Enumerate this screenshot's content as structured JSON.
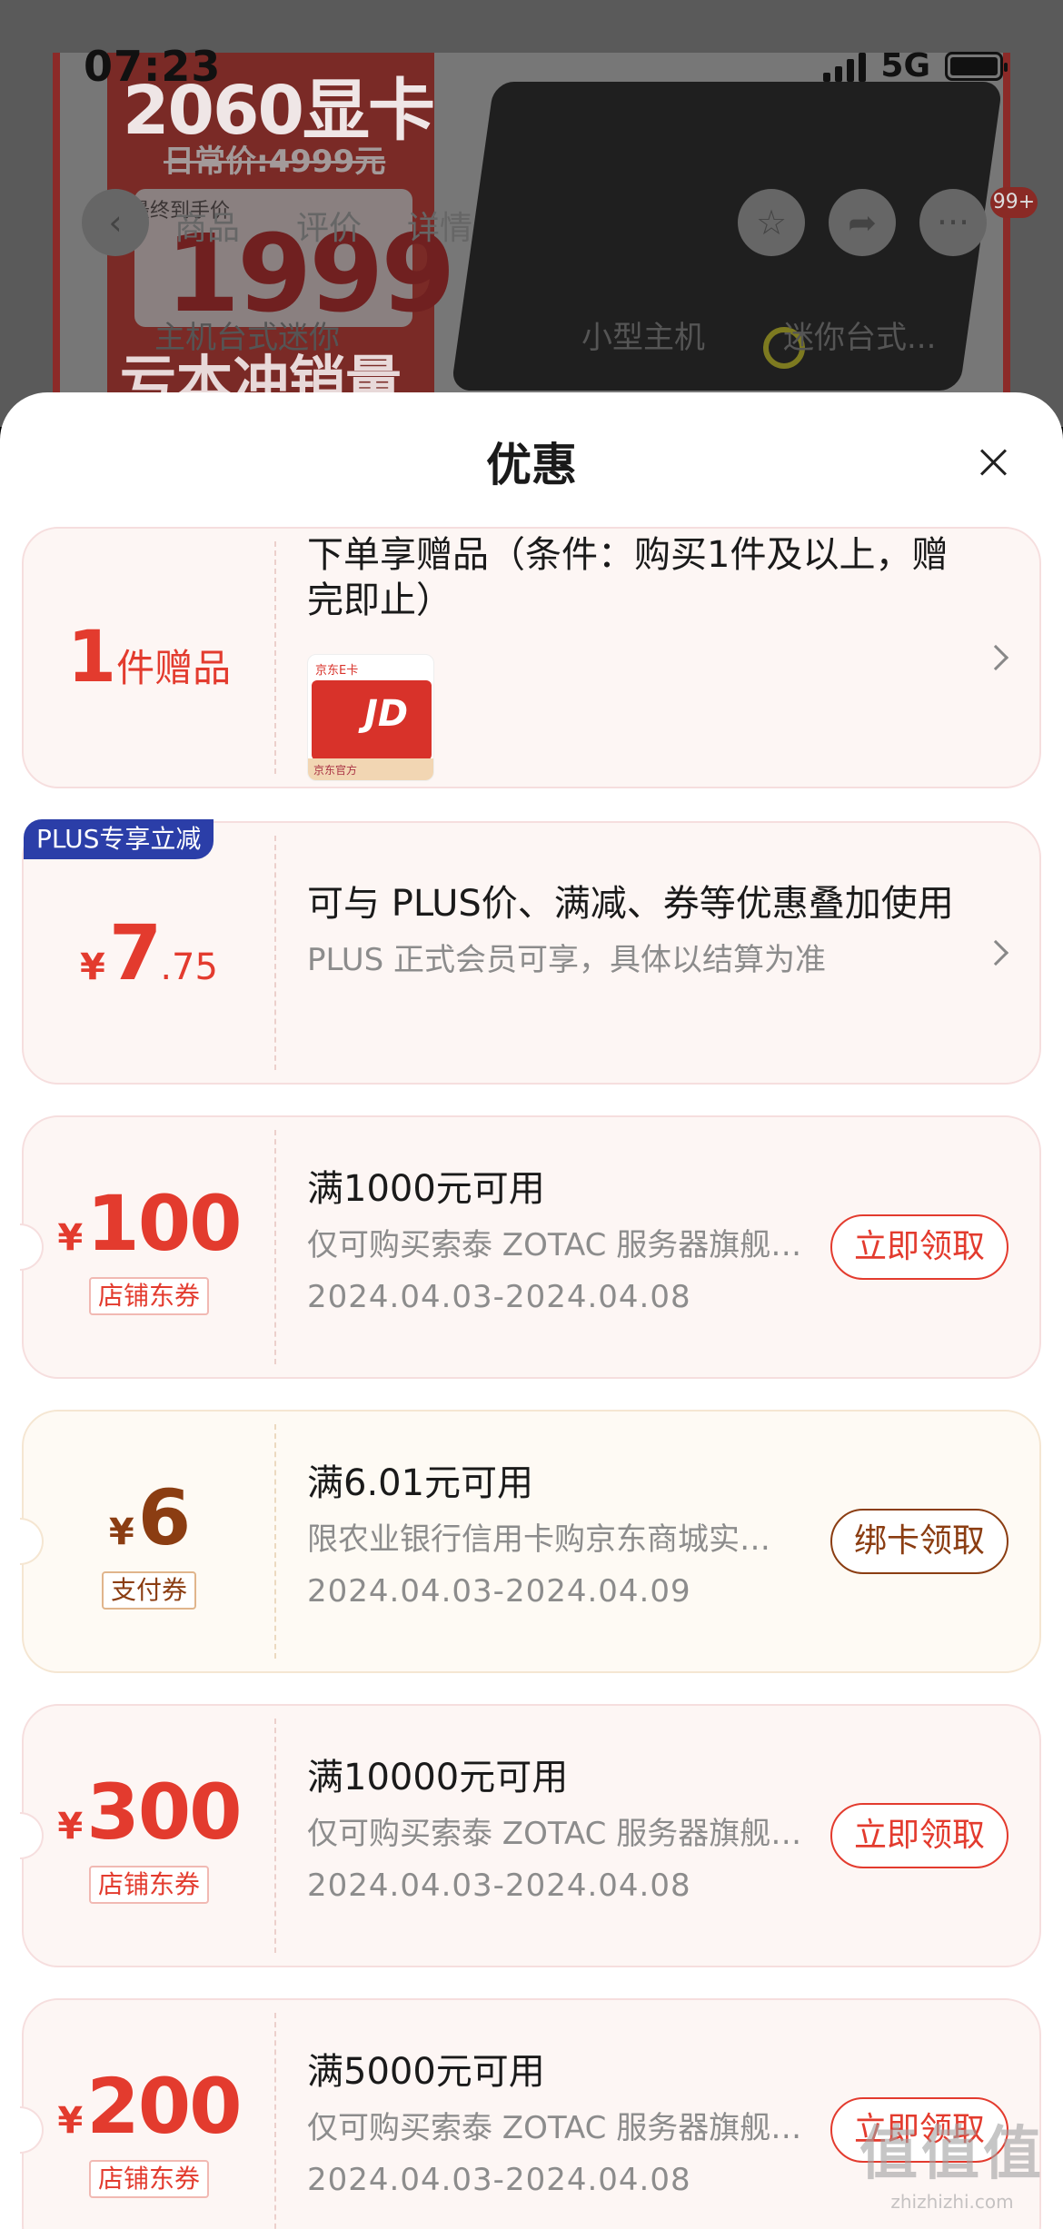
{
  "status_bar": {
    "time": "07:23",
    "network": "5G"
  },
  "background_page": {
    "product_title": "2060显卡",
    "original_price": "日常价:4999元",
    "final_price_label": "最终到手价",
    "final_price": "1999",
    "slogan": "亏本冲销量",
    "tabs": [
      "商品",
      "评价",
      "详情"
    ],
    "cart_badge": "99+",
    "sub_tabs": [
      "主机台式迷你",
      "小型主机",
      "迷你台式..."
    ]
  },
  "sheet": {
    "title": "优惠",
    "gift": {
      "count": "1",
      "label": "件赠品",
      "title": "下单享赠品（条件：购买1件及以上，赠完即止）",
      "card_top_text": "京东E卡",
      "card_logo": "JD",
      "card_strip_text": "京东官方"
    },
    "plus": {
      "badge": "PLUS专享立减",
      "yen": "¥",
      "amount_int": "7",
      "amount_dec": ".75",
      "title": "可与 PLUS价、满减、券等优惠叠加使用",
      "subtitle": "PLUS 正式会员可享，具体以结算为准"
    },
    "coupons": [
      {
        "yen": "¥",
        "amount": "100",
        "tag": "店铺东券",
        "title": "满1000元可用",
        "desc": "仅可购买索泰 ZOTAC 服务器旗舰店部分商品",
        "date": "2024.04.03-2024.04.08",
        "button": "立即领取",
        "kind": "shop"
      },
      {
        "yen": "¥",
        "amount": "6",
        "tag": "支付券",
        "title": "满6.01元可用",
        "desc": "限农业银行信用卡购京东商城实物商品",
        "date": "2024.04.03-2024.04.09",
        "button": "绑卡领取",
        "kind": "pay"
      },
      {
        "yen": "¥",
        "amount": "300",
        "tag": "店铺东券",
        "title": "满10000元可用",
        "desc": "仅可购买索泰 ZOTAC 服务器旗舰店部分商品",
        "date": "2024.04.03-2024.04.08",
        "button": "立即领取",
        "kind": "shop"
      },
      {
        "yen": "¥",
        "amount": "200",
        "tag": "店铺东券",
        "title": "满5000元可用",
        "desc": "仅可购买索泰 ZOTAC 服务器旗舰店部分商品",
        "date": "2024.04.03-2024.04.08",
        "button": "立即领取",
        "kind": "shop"
      }
    ]
  },
  "watermark": {
    "line1": "值值值",
    "line2": "zhizhizhi.com"
  },
  "icons": {
    "back": "back-arrow-icon",
    "favorite": "star-icon",
    "share": "share-icon",
    "more": "more-icon",
    "close": "close-icon",
    "chevron": "chevron-right-icon"
  }
}
